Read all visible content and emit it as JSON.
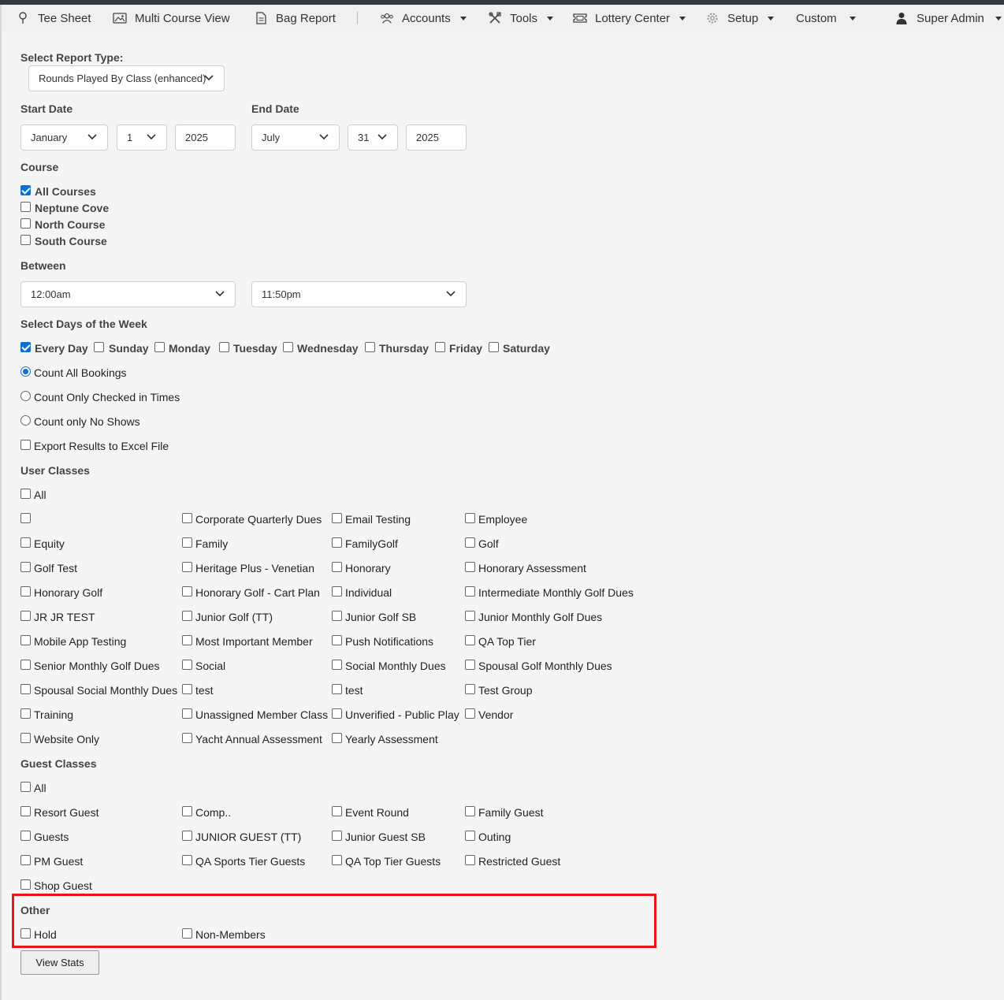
{
  "nav": {
    "tee_sheet": "Tee Sheet",
    "multi_course": "Multi Course View",
    "bag_report": "Bag Report",
    "accounts": "Accounts",
    "tools": "Tools",
    "lottery": "Lottery Center",
    "setup": "Setup",
    "custom": "Custom",
    "user": "Super Admin"
  },
  "report": {
    "type_label": "Select Report Type:",
    "type_value": "Rounds Played By Class (enhanced)"
  },
  "dates": {
    "start_label": "Start Date",
    "start_month": "January",
    "start_day": "1",
    "start_year": "2025",
    "end_label": "End Date",
    "end_month": "July",
    "end_day": "31",
    "end_year": "2025"
  },
  "course": {
    "label": "Course",
    "items": [
      {
        "label": "All Courses",
        "checked": true
      },
      {
        "label": "Neptune Cove",
        "checked": false
      },
      {
        "label": "North Course",
        "checked": false
      },
      {
        "label": "South Course",
        "checked": false
      }
    ]
  },
  "between": {
    "label": "Between",
    "from": "12:00am",
    "to": "11:50pm"
  },
  "days": {
    "label": "Select Days of the Week",
    "items": [
      {
        "label": "Every Day",
        "checked": true
      },
      {
        "label": "Sunday",
        "checked": false
      },
      {
        "label": "Monday",
        "checked": false
      },
      {
        "label": "Tuesday",
        "checked": false
      },
      {
        "label": "Wednesday",
        "checked": false
      },
      {
        "label": "Thursday",
        "checked": false
      },
      {
        "label": "Friday",
        "checked": false
      },
      {
        "label": "Saturday",
        "checked": false
      }
    ]
  },
  "count_options": [
    {
      "label": "Count All Bookings",
      "selected": true
    },
    {
      "label": "Count Only Checked in Times",
      "selected": false
    },
    {
      "label": "Count only No Shows",
      "selected": false
    }
  ],
  "export_label": "Export Results to Excel File",
  "user_classes": {
    "label": "User Classes",
    "all_label": "All",
    "items": [
      "",
      "Corporate Quarterly Dues",
      "Email Testing",
      "Employee",
      "Equity",
      "Family",
      "FamilyGolf",
      "Golf",
      "Golf Test",
      "Heritage Plus - Venetian",
      "Honorary",
      "Honorary Assessment",
      "Honorary Golf",
      "Honorary Golf - Cart Plan",
      "Individual",
      "Intermediate Monthly Golf Dues",
      "JR JR TEST",
      "Junior Golf (TT)",
      "Junior Golf SB",
      "Junior Monthly Golf Dues",
      "Mobile App Testing",
      "Most Important Member",
      "Push Notifications",
      "QA Top Tier",
      "Senior Monthly Golf Dues",
      "Social",
      "Social Monthly Dues",
      "Spousal Golf Monthly Dues",
      "Spousal Social Monthly Dues",
      "test",
      "test",
      "Test Group",
      "Training",
      "Unassigned Member Class",
      "Unverified - Public Play",
      "Vendor",
      "Website Only",
      "Yacht Annual Assessment",
      "Yearly Assessment"
    ]
  },
  "guest_classes": {
    "label": "Guest Classes",
    "all_label": "All",
    "items": [
      "Resort Guest",
      "Comp..",
      "Event Round",
      "Family Guest",
      "Guests",
      "JUNIOR GUEST (TT)",
      "Junior Guest SB",
      "Outing",
      "PM Guest",
      "QA Sports Tier Guests",
      "QA Top Tier Guests",
      "Restricted Guest",
      "Shop Guest"
    ]
  },
  "other": {
    "label": "Other",
    "items": [
      "Hold",
      "Non-Members"
    ]
  },
  "view_button": "View Stats",
  "colors": {
    "accent": "#0b6fd6",
    "highlight_box": "#e8141c",
    "nav_bg": "#f0f0f0",
    "page_bg": "#f5f5f5"
  }
}
